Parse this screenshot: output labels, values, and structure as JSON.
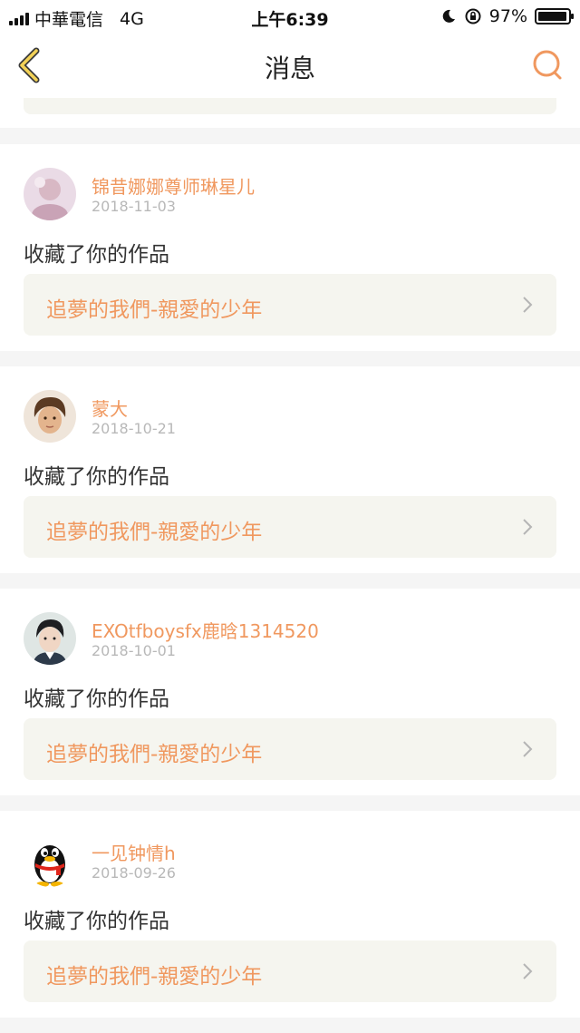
{
  "status_bar": {
    "carrier": "中華電信",
    "network": "4G",
    "time": "上午6:39",
    "battery": "97%",
    "battery_level": 0.97
  },
  "nav": {
    "title": "消息",
    "back_icon": "chevron-left-icon",
    "search_icon": "search-icon"
  },
  "colors": {
    "accent": "#f0985f",
    "card_link_bg": "#f5f5ef",
    "page_bg": "#f5f5f5"
  },
  "messages": [
    {
      "username": "锦昔娜娜尊师琳星儿",
      "date": "2018-11-03",
      "action": "收藏了你的作品",
      "work_title": "追夢的我們-親愛的少年",
      "avatar": "avatar-photo-icon"
    },
    {
      "username": "蒙大",
      "date": "2018-10-21",
      "action": "收藏了你的作品",
      "work_title": "追夢的我們-親愛的少年",
      "avatar": "avatar-photo-icon"
    },
    {
      "username": "EXOtfboysfx鹿晗1314520",
      "date": "2018-10-01",
      "action": "收藏了你的作品",
      "work_title": "追夢的我們-親愛的少年",
      "avatar": "avatar-photo-icon"
    },
    {
      "username": "一见钟情h",
      "date": "2018-09-26",
      "action": "收藏了你的作品",
      "work_title": "追夢的我們-親愛的少年",
      "avatar": "qq-penguin-icon"
    }
  ]
}
